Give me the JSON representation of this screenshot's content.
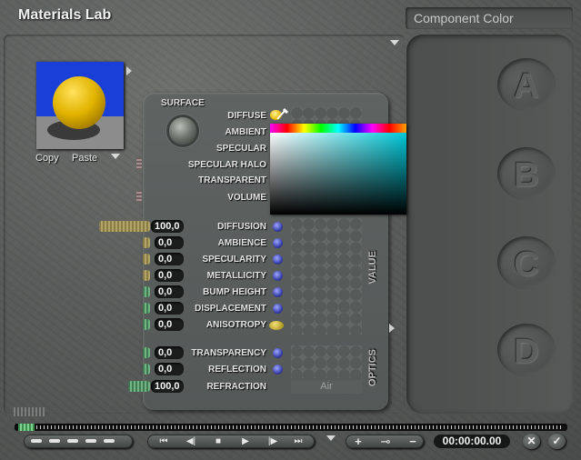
{
  "app": {
    "title": "Materials Lab",
    "component_color": "Component Color"
  },
  "slots": [
    "A",
    "B",
    "C",
    "D"
  ],
  "preview": {
    "copy_label": "Copy",
    "paste_label": "Paste"
  },
  "surface": {
    "title": "SURFACE",
    "channels": [
      "DIFFUSE",
      "AMBIENT",
      "SPECULAR",
      "SPECULAR HALO",
      "TRANSPARENT",
      "VOLUME"
    ],
    "diffuse_swatch_color": "#e8b800"
  },
  "value": {
    "tab_label": "VALUE",
    "rows": [
      {
        "label": "DIFFUSION",
        "value": "100,0"
      },
      {
        "label": "AMBIENCE",
        "value": "0,0"
      },
      {
        "label": "SPECULARITY",
        "value": "0,0"
      },
      {
        "label": "METALLICITY",
        "value": "0,0"
      },
      {
        "label": "BUMP HEIGHT",
        "value": "0,0"
      },
      {
        "label": "DISPLACEMENT",
        "value": "0,0"
      },
      {
        "label": "ANISOTROPY",
        "value": "0,0"
      }
    ]
  },
  "optics": {
    "tab_label": "OPTICS",
    "rows": [
      {
        "label": "TRANSPARENCY",
        "value": "0,0"
      },
      {
        "label": "REFLECTION",
        "value": "0,0"
      },
      {
        "label": "REFRACTION",
        "value": "100,0"
      }
    ],
    "refraction_preset": "Air"
  },
  "picker": {
    "hue_start": "#ff00ff",
    "sv_color": "#00c8d8"
  },
  "transport": {
    "time": "00:00:00.00",
    "buttons": [
      "⏮",
      "◀|",
      "■",
      "▶",
      "|▶",
      "⏭"
    ],
    "add_label": "+",
    "key_label": "⊸",
    "remove_label": "−",
    "cancel_label": "✕",
    "ok_label": "✓"
  },
  "colors": {
    "accent_yellow": "#e8b800",
    "knob_green": "#72b384",
    "knob_tan": "#b3a46a",
    "dot_blue": "#3840a8"
  }
}
